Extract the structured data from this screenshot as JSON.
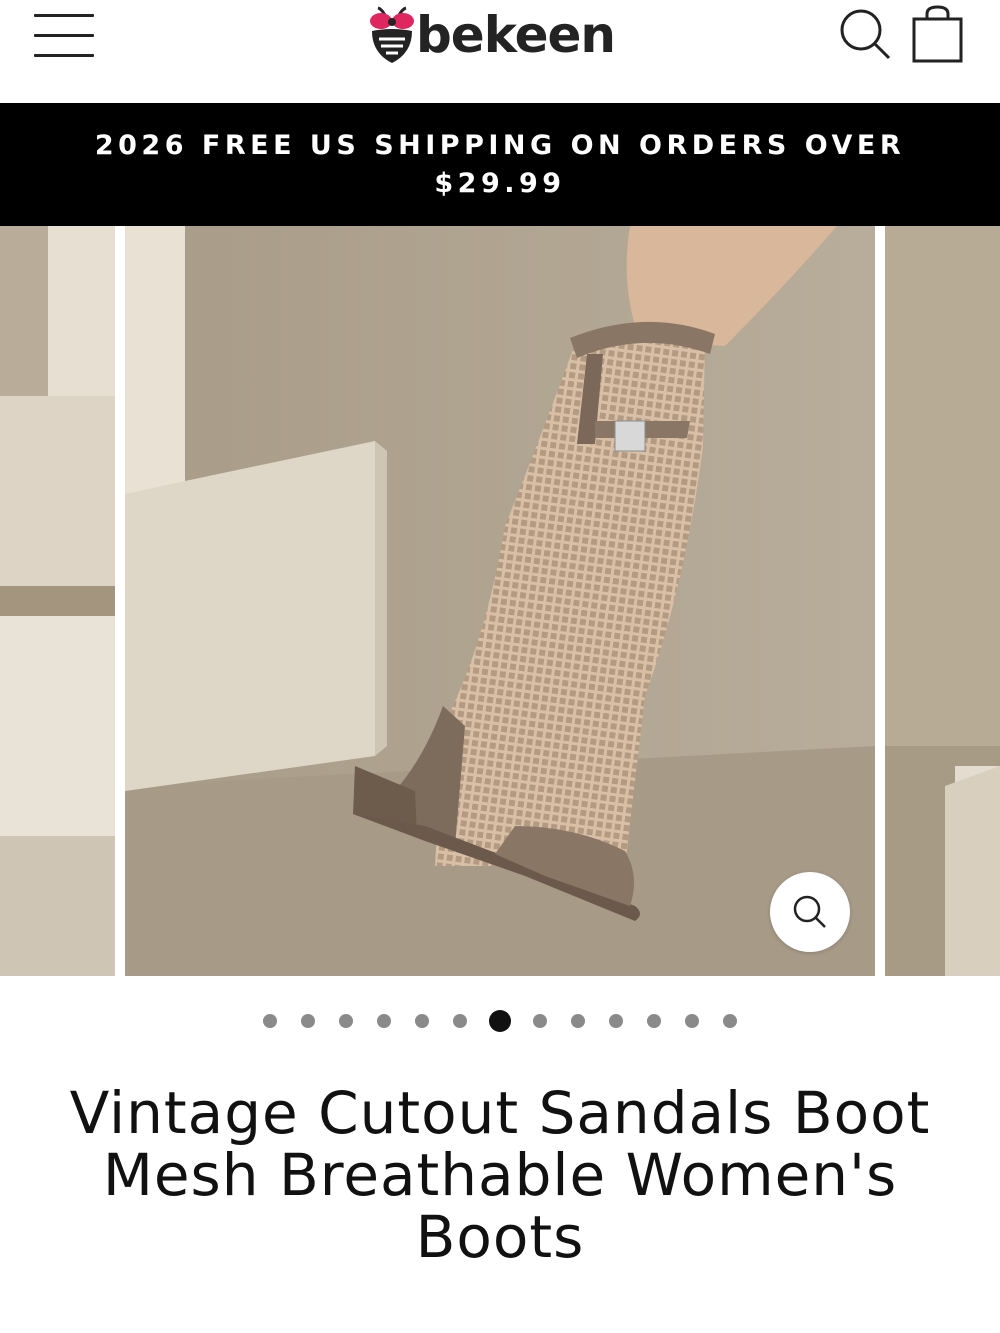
{
  "header": {
    "brand_name": "bekeen",
    "menu_icon": "hamburger-menu-icon",
    "search_icon": "search-icon",
    "cart_icon": "shopping-bag-icon"
  },
  "announcement": {
    "text": "2026 FREE US SHIPPING ON ORDERS OVER $29.99"
  },
  "gallery": {
    "zoom_icon": "zoom-icon",
    "slide_count": 13,
    "active_index": 6
  },
  "product": {
    "title": "Vintage Cutout Sandals Boot Mesh Breathable Women's Boots"
  },
  "colors": {
    "announcement_bg": "#000000",
    "announcement_text": "#ffffff",
    "logo_bee_pink": "#e0265e",
    "backdrop_beige": "#b7ab98",
    "boot_taupe": "#8a7665"
  }
}
